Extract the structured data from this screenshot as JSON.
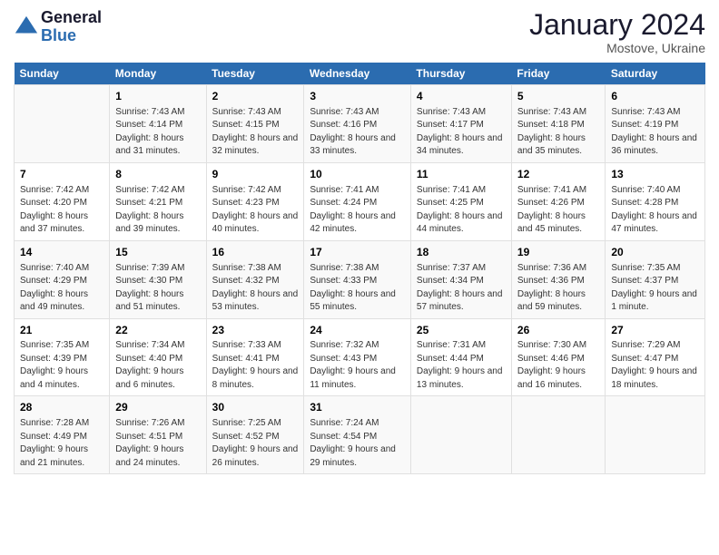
{
  "header": {
    "logo_line1": "General",
    "logo_line2": "Blue",
    "title": "January 2024",
    "subtitle": "Mostove, Ukraine"
  },
  "columns": [
    "Sunday",
    "Monday",
    "Tuesday",
    "Wednesday",
    "Thursday",
    "Friday",
    "Saturday"
  ],
  "rows": [
    [
      {
        "num": "",
        "sunrise": "",
        "sunset": "",
        "daylight": ""
      },
      {
        "num": "1",
        "sunrise": "Sunrise: 7:43 AM",
        "sunset": "Sunset: 4:14 PM",
        "daylight": "Daylight: 8 hours and 31 minutes."
      },
      {
        "num": "2",
        "sunrise": "Sunrise: 7:43 AM",
        "sunset": "Sunset: 4:15 PM",
        "daylight": "Daylight: 8 hours and 32 minutes."
      },
      {
        "num": "3",
        "sunrise": "Sunrise: 7:43 AM",
        "sunset": "Sunset: 4:16 PM",
        "daylight": "Daylight: 8 hours and 33 minutes."
      },
      {
        "num": "4",
        "sunrise": "Sunrise: 7:43 AM",
        "sunset": "Sunset: 4:17 PM",
        "daylight": "Daylight: 8 hours and 34 minutes."
      },
      {
        "num": "5",
        "sunrise": "Sunrise: 7:43 AM",
        "sunset": "Sunset: 4:18 PM",
        "daylight": "Daylight: 8 hours and 35 minutes."
      },
      {
        "num": "6",
        "sunrise": "Sunrise: 7:43 AM",
        "sunset": "Sunset: 4:19 PM",
        "daylight": "Daylight: 8 hours and 36 minutes."
      }
    ],
    [
      {
        "num": "7",
        "sunrise": "Sunrise: 7:42 AM",
        "sunset": "Sunset: 4:20 PM",
        "daylight": "Daylight: 8 hours and 37 minutes."
      },
      {
        "num": "8",
        "sunrise": "Sunrise: 7:42 AM",
        "sunset": "Sunset: 4:21 PM",
        "daylight": "Daylight: 8 hours and 39 minutes."
      },
      {
        "num": "9",
        "sunrise": "Sunrise: 7:42 AM",
        "sunset": "Sunset: 4:23 PM",
        "daylight": "Daylight: 8 hours and 40 minutes."
      },
      {
        "num": "10",
        "sunrise": "Sunrise: 7:41 AM",
        "sunset": "Sunset: 4:24 PM",
        "daylight": "Daylight: 8 hours and 42 minutes."
      },
      {
        "num": "11",
        "sunrise": "Sunrise: 7:41 AM",
        "sunset": "Sunset: 4:25 PM",
        "daylight": "Daylight: 8 hours and 44 minutes."
      },
      {
        "num": "12",
        "sunrise": "Sunrise: 7:41 AM",
        "sunset": "Sunset: 4:26 PM",
        "daylight": "Daylight: 8 hours and 45 minutes."
      },
      {
        "num": "13",
        "sunrise": "Sunrise: 7:40 AM",
        "sunset": "Sunset: 4:28 PM",
        "daylight": "Daylight: 8 hours and 47 minutes."
      }
    ],
    [
      {
        "num": "14",
        "sunrise": "Sunrise: 7:40 AM",
        "sunset": "Sunset: 4:29 PM",
        "daylight": "Daylight: 8 hours and 49 minutes."
      },
      {
        "num": "15",
        "sunrise": "Sunrise: 7:39 AM",
        "sunset": "Sunset: 4:30 PM",
        "daylight": "Daylight: 8 hours and 51 minutes."
      },
      {
        "num": "16",
        "sunrise": "Sunrise: 7:38 AM",
        "sunset": "Sunset: 4:32 PM",
        "daylight": "Daylight: 8 hours and 53 minutes."
      },
      {
        "num": "17",
        "sunrise": "Sunrise: 7:38 AM",
        "sunset": "Sunset: 4:33 PM",
        "daylight": "Daylight: 8 hours and 55 minutes."
      },
      {
        "num": "18",
        "sunrise": "Sunrise: 7:37 AM",
        "sunset": "Sunset: 4:34 PM",
        "daylight": "Daylight: 8 hours and 57 minutes."
      },
      {
        "num": "19",
        "sunrise": "Sunrise: 7:36 AM",
        "sunset": "Sunset: 4:36 PM",
        "daylight": "Daylight: 8 hours and 59 minutes."
      },
      {
        "num": "20",
        "sunrise": "Sunrise: 7:35 AM",
        "sunset": "Sunset: 4:37 PM",
        "daylight": "Daylight: 9 hours and 1 minute."
      }
    ],
    [
      {
        "num": "21",
        "sunrise": "Sunrise: 7:35 AM",
        "sunset": "Sunset: 4:39 PM",
        "daylight": "Daylight: 9 hours and 4 minutes."
      },
      {
        "num": "22",
        "sunrise": "Sunrise: 7:34 AM",
        "sunset": "Sunset: 4:40 PM",
        "daylight": "Daylight: 9 hours and 6 minutes."
      },
      {
        "num": "23",
        "sunrise": "Sunrise: 7:33 AM",
        "sunset": "Sunset: 4:41 PM",
        "daylight": "Daylight: 9 hours and 8 minutes."
      },
      {
        "num": "24",
        "sunrise": "Sunrise: 7:32 AM",
        "sunset": "Sunset: 4:43 PM",
        "daylight": "Daylight: 9 hours and 11 minutes."
      },
      {
        "num": "25",
        "sunrise": "Sunrise: 7:31 AM",
        "sunset": "Sunset: 4:44 PM",
        "daylight": "Daylight: 9 hours and 13 minutes."
      },
      {
        "num": "26",
        "sunrise": "Sunrise: 7:30 AM",
        "sunset": "Sunset: 4:46 PM",
        "daylight": "Daylight: 9 hours and 16 minutes."
      },
      {
        "num": "27",
        "sunrise": "Sunrise: 7:29 AM",
        "sunset": "Sunset: 4:47 PM",
        "daylight": "Daylight: 9 hours and 18 minutes."
      }
    ],
    [
      {
        "num": "28",
        "sunrise": "Sunrise: 7:28 AM",
        "sunset": "Sunset: 4:49 PM",
        "daylight": "Daylight: 9 hours and 21 minutes."
      },
      {
        "num": "29",
        "sunrise": "Sunrise: 7:26 AM",
        "sunset": "Sunset: 4:51 PM",
        "daylight": "Daylight: 9 hours and 24 minutes."
      },
      {
        "num": "30",
        "sunrise": "Sunrise: 7:25 AM",
        "sunset": "Sunset: 4:52 PM",
        "daylight": "Daylight: 9 hours and 26 minutes."
      },
      {
        "num": "31",
        "sunrise": "Sunrise: 7:24 AM",
        "sunset": "Sunset: 4:54 PM",
        "daylight": "Daylight: 9 hours and 29 minutes."
      },
      {
        "num": "",
        "sunrise": "",
        "sunset": "",
        "daylight": ""
      },
      {
        "num": "",
        "sunrise": "",
        "sunset": "",
        "daylight": ""
      },
      {
        "num": "",
        "sunrise": "",
        "sunset": "",
        "daylight": ""
      }
    ]
  ]
}
